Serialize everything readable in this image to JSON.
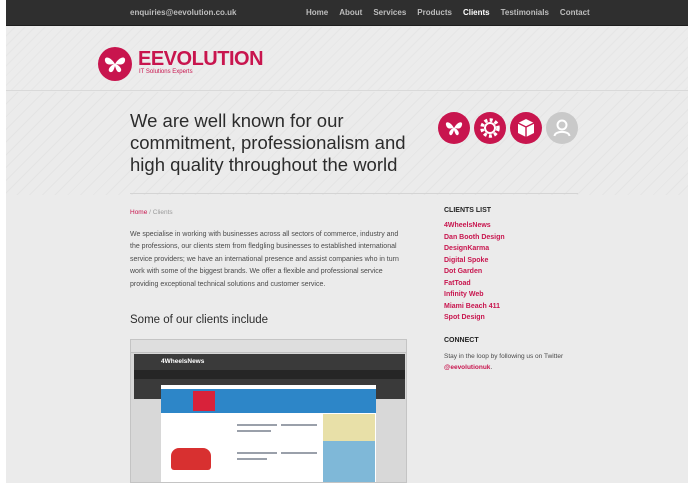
{
  "topbar": {
    "email": "enquiries@eevolution.co.uk",
    "nav": [
      "Home",
      "About",
      "Services",
      "Products",
      "Clients",
      "Testimonials",
      "Contact"
    ],
    "active": "Clients"
  },
  "brand": {
    "name": "EEVOLUTION",
    "tagline": "IT Solutions Experts",
    "accent": "#c8154e"
  },
  "hero": {
    "headline": "We are well known for our commitment, professionalism and high quality throughout the world",
    "icons": [
      "butterfly-icon",
      "gear-icon",
      "box-icon",
      "user-icon"
    ]
  },
  "breadcrumb": {
    "home": "Home",
    "separator": "/",
    "current": "Clients"
  },
  "main": {
    "intro": "We specialise in working with businesses across all sectors of commerce, industry and the professions, our clients stem from fledgling businesses to established international service providers; we have an international presence and assist companies who in turn work with some of the biggest brands. We offer a flexible and professional service providing exceptional technical solutions and customer service.",
    "subheading": "Some of our clients include",
    "screenshot_site": "4WheelsNews"
  },
  "sidebar": {
    "clients_heading": "CLIENTS LIST",
    "clients": [
      "4WheelsNews",
      "Dan Booth Design",
      "DesignKarma",
      "Digital Spoke",
      "Dot Garden",
      "FatToad",
      "Infinity Web",
      "Miami Beach 411",
      "Spot Design"
    ],
    "connect_heading": "CONNECT",
    "connect_text": "Stay in the loop by following us on Twitter",
    "twitter_handle": "@eevolutionuk",
    "connect_end": "."
  }
}
